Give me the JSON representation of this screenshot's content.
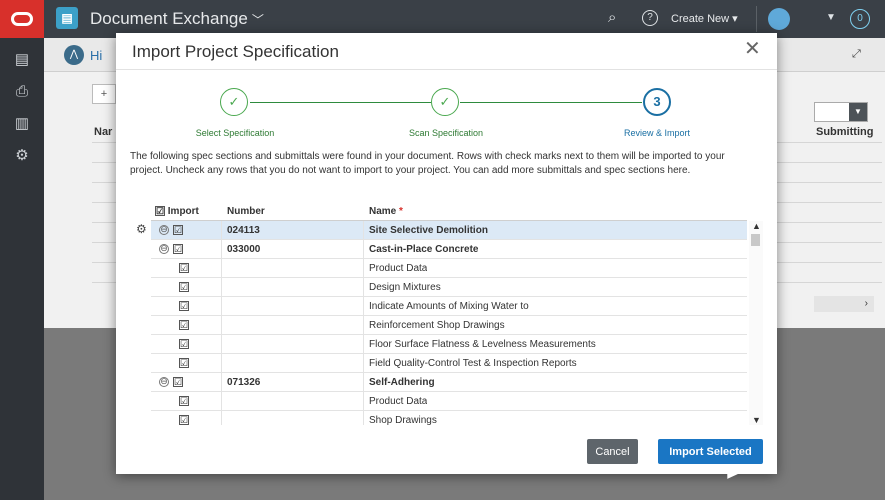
{
  "app": {
    "title": "Document Exchange",
    "title_chevron": "﹀",
    "create_new": "Create New ▾",
    "notification": "0",
    "help": "?",
    "breadcrumb": "Hi",
    "col_name": "Nar",
    "col_submitting": "Submitting"
  },
  "modal": {
    "title": "Import Project Specification",
    "close": "✕",
    "steps": [
      {
        "label": "Select Specification",
        "state": "complete",
        "mark": "✓"
      },
      {
        "label": "Scan Specification",
        "state": "complete",
        "mark": "✓"
      },
      {
        "label": "Review & Import",
        "state": "active",
        "mark": "3"
      }
    ],
    "intro": "The following spec sections and submittals were found in your document. Rows with check marks next to them will be imported to your project. Uncheck any rows that you do not want to import to your project. You can add more submittals and spec sections here.",
    "table": {
      "headers": {
        "import": "Import",
        "number": "Number",
        "name": "Name",
        "required_mark": "*"
      },
      "rows": [
        {
          "level": "section",
          "number": "024113",
          "name": "Site Selective Demolition",
          "selected": true
        },
        {
          "level": "section",
          "number": "033000",
          "name": "Cast-in-Place Concrete",
          "selected": false
        },
        {
          "level": "submittal",
          "number": "",
          "name": "Product Data",
          "selected": false
        },
        {
          "level": "submittal",
          "number": "",
          "name": "Design Mixtures",
          "selected": false
        },
        {
          "level": "submittal",
          "number": "",
          "name": "Indicate Amounts of Mixing Water to",
          "selected": false
        },
        {
          "level": "submittal",
          "number": "",
          "name": "Reinforcement Shop Drawings",
          "selected": false
        },
        {
          "level": "submittal",
          "number": "",
          "name": "Floor Surface Flatness & Levelness Measurements",
          "selected": false
        },
        {
          "level": "submittal",
          "number": "",
          "name": "Field Quality-Control Test & Inspection Reports",
          "selected": false
        },
        {
          "level": "section",
          "number": "071326",
          "name": "Self-Adhering",
          "selected": false
        },
        {
          "level": "submittal",
          "number": "",
          "name": "Product Data",
          "selected": false
        },
        {
          "level": "submittal",
          "number": "",
          "name": "Shop Drawings",
          "selected": false
        }
      ]
    },
    "buttons": {
      "cancel": "Cancel",
      "import": "Import Selected"
    }
  },
  "icons": {
    "checkbox": "☑",
    "collapse": "⊖",
    "gear": "⚙"
  },
  "colors": {
    "accent": "#1a76c4",
    "step_complete": "#4aa84f",
    "step_active": "#1a6fa3",
    "brand_red": "#d8302b"
  }
}
